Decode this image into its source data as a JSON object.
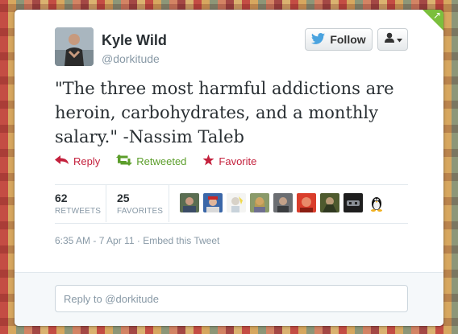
{
  "user": {
    "name": "Kyle Wild",
    "handle": "@dorkitude"
  },
  "buttons": {
    "follow_label": "Follow",
    "user_menu_icon": "user-dropdown-icon"
  },
  "tweet": {
    "text": "\"The three most harmful addictions are heroin, carbohydrates, and a monthly salary.\" -Nassim Taleb"
  },
  "actions": {
    "reply_label": "Reply",
    "retweeted_label": "Retweeted",
    "favorite_label": "Favorite"
  },
  "stats": {
    "retweets_count": "62",
    "retweets_label": "RETWEETS",
    "favorites_count": "25",
    "favorites_label": "FAVORITES"
  },
  "meta": {
    "timestamp": "6:35 AM - 7 Apr 11",
    "separator": "·",
    "embed_label": "Embed this Tweet"
  },
  "reply_box": {
    "placeholder": "Reply to @dorkitude"
  },
  "colors": {
    "reply": "#c4213d",
    "retweeted": "#5c9e2b",
    "favorite": "#c4213d",
    "twitter_bird": "#4aa3df",
    "corner": "#7bbf3c"
  }
}
